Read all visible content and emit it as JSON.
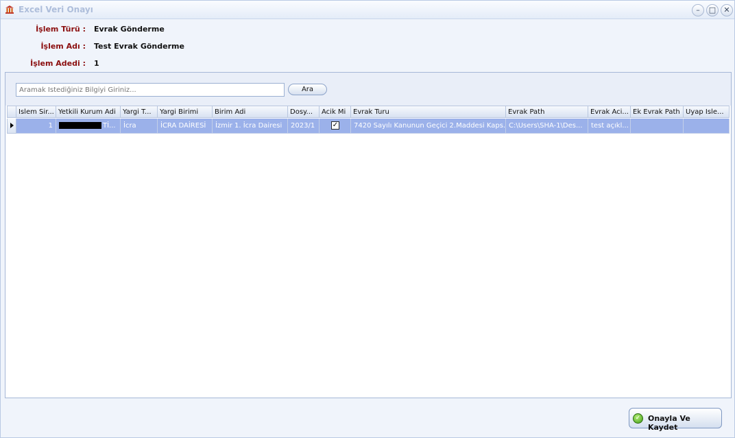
{
  "window": {
    "title": "Excel Veri Onayı",
    "icon": "building-icon"
  },
  "window_controls": {
    "minimize": "–",
    "maximize": "□",
    "close": "✕"
  },
  "info": {
    "islem_turu_label": "İşlem Türü :",
    "islem_turu_value": "Evrak Gönderme",
    "islem_adi_label": "İşlem Adı :",
    "islem_adi_value": "Test Evrak Gönderme",
    "islem_adedi_label": "İşlem Adedi :",
    "islem_adedi_value": "1"
  },
  "search": {
    "placeholder": "Aramak İstediğiniz Bilgiyi Giriniz...",
    "button_label": "Ara"
  },
  "table": {
    "columns": [
      "Islem Sir...",
      "Yetkili Kurum Adi",
      "Yargi T...",
      "Yargi Birimi",
      "Birim Adi",
      "Dosy...",
      "Acik Mi",
      "Evrak Turu",
      "Evrak Path",
      "Evrak Aci...",
      "Ek Evrak Path",
      "Uyap Isle..."
    ],
    "rows": [
      {
        "islem_sira": "1",
        "yetkili_kurum_adi": "Tİ...",
        "yargi_turu": "İcra",
        "yargi_birimi": "İCRA DAİRESİ",
        "birim_adi": "İzmir 1. İcra Dairesi",
        "dosya": "2023/1",
        "acik_mi": "✓",
        "evrak_turu": "7420 Sayılı Kanunun Geçici 2.Maddesi Kaps...",
        "evrak_path": "C:\\Users\\SHA-1\\Des...",
        "evrak_aciklama": "test açıkl...",
        "ek_evrak_path": "",
        "uyap_islem": ""
      }
    ]
  },
  "footer": {
    "save_label": "Onayla Ve Kaydet",
    "save_icon": "check-circle-icon"
  }
}
